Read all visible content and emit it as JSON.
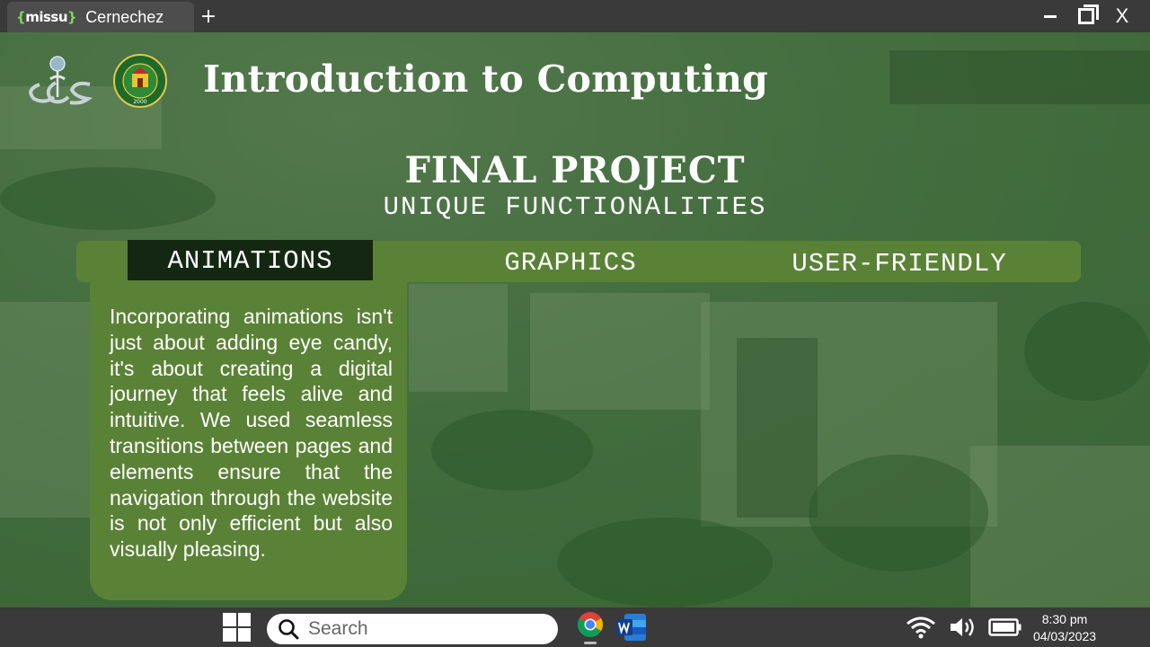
{
  "browser": {
    "tab_logo": "missu",
    "tab_title": "Cernechez",
    "new_tab": "+",
    "close": "X"
  },
  "slide": {
    "course_title": "Introduction to Computing",
    "final_title": "FINAL PROJECT",
    "final_subtitle": "UNIQUE FUNCTIONALITIES",
    "seal_year": "2000",
    "tabs": [
      {
        "label": "ANIMATIONS",
        "active": true
      },
      {
        "label": "GRAPHICS",
        "active": false
      },
      {
        "label": "USER-FRIENDLY",
        "active": false
      }
    ],
    "content": "Incorporating animations isn't just about adding eye candy, it's about creating a digital journey that feels alive and intuitive. We used seamless transitions between pages and elements ensure that the navigation through the website is not only efficient but also visually pleasing."
  },
  "taskbar": {
    "search_placeholder": "Search",
    "time": "8:30 pm",
    "date": "04/03/2023"
  },
  "colors": {
    "tab_bar": "#5a8236",
    "active_tab": "#142713",
    "chrome_bar": "#3a3a3a"
  }
}
